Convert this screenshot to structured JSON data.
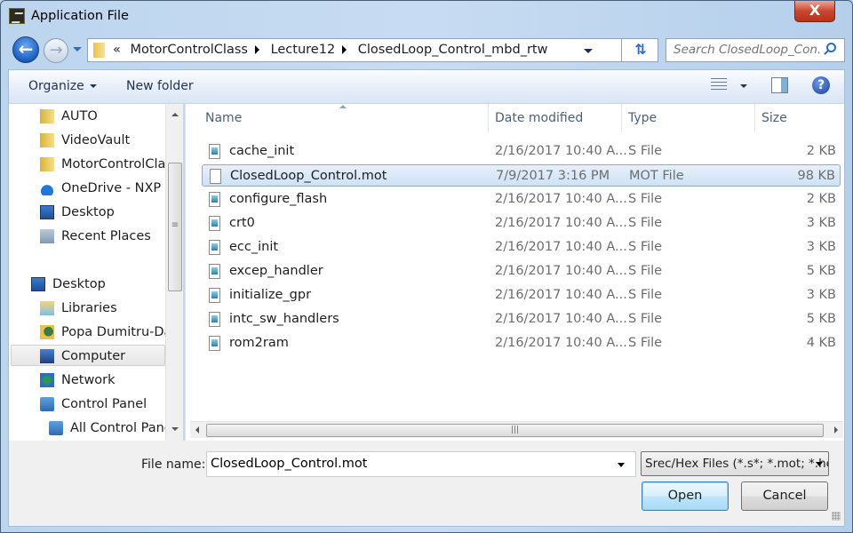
{
  "window": {
    "title": "Application File",
    "close_label": "X"
  },
  "nav": {
    "breadcrumb_prefix": "«",
    "breadcrumbs": [
      "MotorControlClass",
      "Lecture12",
      "ClosedLoop_Control_mbd_rtw"
    ],
    "search_placeholder": "Search ClosedLoop_Con..."
  },
  "toolbar": {
    "organize": "Organize",
    "new_folder": "New folder",
    "help": "?"
  },
  "sidebar": {
    "items": [
      {
        "label": "AUTO",
        "icon": "folder-icon"
      },
      {
        "label": "VideoVault",
        "icon": "folder-icon"
      },
      {
        "label": "MotorControlClass",
        "icon": "folder-icon"
      },
      {
        "label": "OneDrive - NXP",
        "icon": "cloud-icon"
      },
      {
        "label": "Desktop",
        "icon": "desktop-icon"
      },
      {
        "label": "Recent Places",
        "icon": "recent-places-icon"
      },
      {
        "label": "Desktop",
        "icon": "desktop-icon"
      },
      {
        "label": "Libraries",
        "icon": "libraries-icon"
      },
      {
        "label": "Popa Dumitru-Daniel",
        "icon": "user-folder-icon"
      },
      {
        "label": "Computer",
        "icon": "computer-icon",
        "selected": true
      },
      {
        "label": "Network",
        "icon": "network-icon"
      },
      {
        "label": "Control Panel",
        "icon": "control-panel-icon"
      },
      {
        "label": "All Control Panel Items",
        "icon": "control-panel-icon"
      }
    ]
  },
  "files": {
    "columns": [
      "Name",
      "Date modified",
      "Type",
      "Size"
    ],
    "rows": [
      {
        "name": "cache_init",
        "date": "2/16/2017 10:40 A...",
        "type": "S File",
        "size": "2 KB"
      },
      {
        "name": "ClosedLoop_Control.mot",
        "date": "7/9/2017 3:16 PM",
        "type": "MOT File",
        "size": "98 KB",
        "selected": true
      },
      {
        "name": "configure_flash",
        "date": "2/16/2017 10:40 A...",
        "type": "S File",
        "size": "2 KB"
      },
      {
        "name": "crt0",
        "date": "2/16/2017 10:40 A...",
        "type": "S File",
        "size": "3 KB"
      },
      {
        "name": "ecc_init",
        "date": "2/16/2017 10:40 A...",
        "type": "S File",
        "size": "3 KB"
      },
      {
        "name": "excep_handler",
        "date": "2/16/2017 10:40 A...",
        "type": "S File",
        "size": "5 KB"
      },
      {
        "name": "initialize_gpr",
        "date": "2/16/2017 10:40 A...",
        "type": "S File",
        "size": "3 KB"
      },
      {
        "name": "intc_sw_handlers",
        "date": "2/16/2017 10:40 A...",
        "type": "S File",
        "size": "5 KB"
      },
      {
        "name": "rom2ram",
        "date": "2/16/2017 10:40 A...",
        "type": "S File",
        "size": "4 KB"
      }
    ]
  },
  "footer": {
    "file_name_label": "File name:",
    "file_name_value": "ClosedLoop_Control.mot",
    "filter": "Srec/Hex Files (*.s*; *.mot; *.hex)",
    "open": "Open",
    "cancel": "Cancel"
  }
}
